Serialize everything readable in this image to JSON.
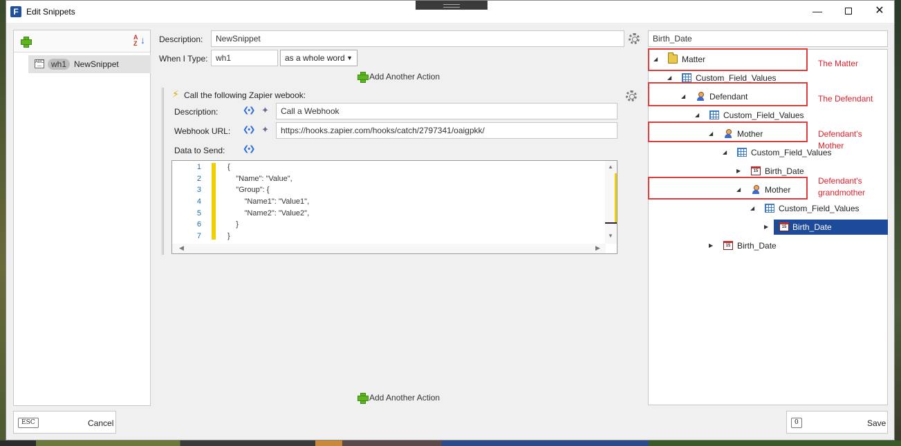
{
  "window": {
    "title": "Edit Snippets",
    "app_icon_letter": "F"
  },
  "left": {
    "snippet": {
      "abbr": "wh1",
      "name": "NewSnippet"
    }
  },
  "form": {
    "description_label": "Description:",
    "description_value": "NewSnippet",
    "when_label": "When I Type:",
    "when_value": "wh1",
    "mode_value": "as a whole word",
    "add_action_label": "Add Another Action"
  },
  "action": {
    "header": "Call the following Zapier webook:",
    "description_label": "Description:",
    "description_value": "Call a Webhook",
    "url_label": "Webhook URL:",
    "url_value": "https://hooks.zapier.com/hooks/catch/2797341/oaigpkk/",
    "data_label": "Data to Send:",
    "code_lines": [
      {
        "num": "1",
        "text": "{"
      },
      {
        "num": "2",
        "text": "    \"Name\": \"Value\","
      },
      {
        "num": "3",
        "text": "    \"Group\": {"
      },
      {
        "num": "4",
        "text": "        \"Name1\": \"Value1\","
      },
      {
        "num": "5",
        "text": "        \"Name2\": \"Value2\","
      },
      {
        "num": "6",
        "text": "    }"
      },
      {
        "num": "7",
        "text": "}"
      }
    ]
  },
  "tree": {
    "search_value": "Birth_Date",
    "nodes": [
      {
        "label": "Matter",
        "icon": "folder-icon",
        "expanded": true
      },
      {
        "label": "Custom_Field_Values",
        "icon": "grid-icon",
        "expanded": true
      },
      {
        "label": "Defendant",
        "icon": "person-icon",
        "expanded": true
      },
      {
        "label": "Custom_Field_Values",
        "icon": "grid-icon",
        "expanded": true
      },
      {
        "label": "Mother",
        "icon": "person-icon",
        "expanded": true
      },
      {
        "label": "Custom_Field_Values",
        "icon": "grid-icon",
        "expanded": true
      },
      {
        "label": "Birth_Date",
        "icon": "calendar-icon",
        "expanded": false
      },
      {
        "label": "Mother",
        "icon": "person-icon",
        "expanded": true
      },
      {
        "label": "Custom_Field_Values",
        "icon": "grid-icon",
        "expanded": true
      },
      {
        "label": "Birth_Date",
        "icon": "calendar-icon",
        "expanded": false,
        "selected": true
      },
      {
        "label": "Birth_Date",
        "icon": "calendar-icon",
        "expanded": false
      }
    ],
    "calendar_glyph": "15"
  },
  "annotations": {
    "matter": "The Matter",
    "defendant": "The Defendant",
    "mother_line1": "Defendant's",
    "mother_line2": "Mother",
    "grand_line1": "Defendant's",
    "grand_line2": "grandmother"
  },
  "footer": {
    "cancel_key": "ESC",
    "cancel_label": "Cancel",
    "save_key": "0",
    "save_label": "Save"
  },
  "colors": {
    "selection": "#1e4a9a",
    "annotation": "#e03a3a",
    "accent_plus": "#5fb520"
  }
}
